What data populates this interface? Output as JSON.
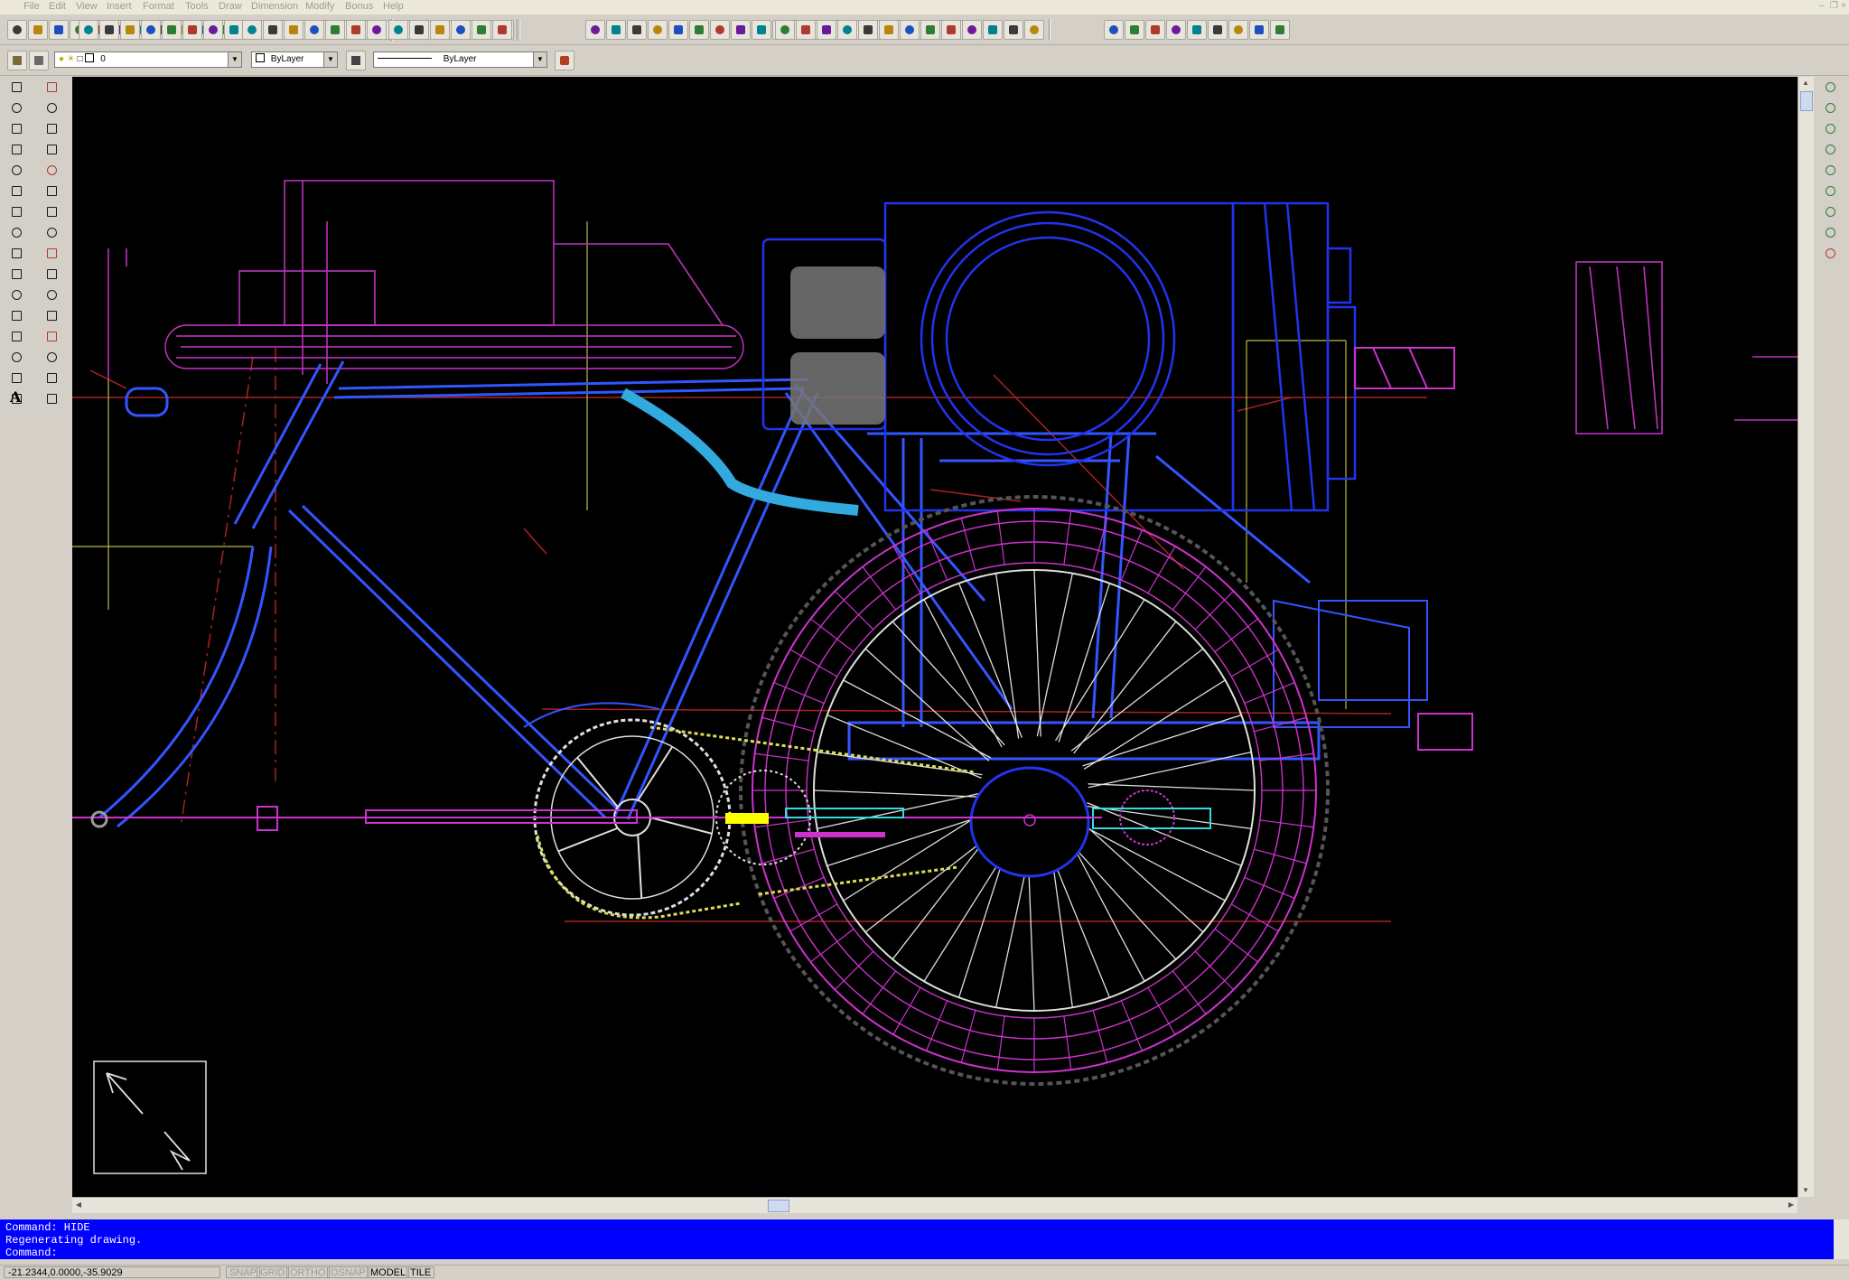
{
  "menu": {
    "items": [
      "File",
      "Edit",
      "View",
      "Insert",
      "Format",
      "Tools",
      "Draw",
      "Dimension",
      "Modify",
      "Bonus",
      "Help"
    ]
  },
  "properties": {
    "layer_name": "0",
    "color": "ByLayer",
    "linetype": "ByLayer"
  },
  "command_history": [
    "Command: HIDE",
    "Regenerating drawing."
  ],
  "command_prompt": "Command:",
  "status": {
    "coordinates": "-21.2344,0.0000,-35.9029",
    "toggles": [
      {
        "label": "SNAP",
        "on": false
      },
      {
        "label": "GRID",
        "on": false
      },
      {
        "label": "ORTHO",
        "on": false
      },
      {
        "label": "OSNAP",
        "on": false
      },
      {
        "label": "MODEL",
        "on": true
      },
      {
        "label": "TILE",
        "on": true
      }
    ]
  },
  "icons": {
    "ucs": "ucs-icon",
    "window_minimize": "minimize-icon",
    "window_restore": "restore-icon",
    "window_close": "close-icon"
  },
  "colors": {
    "canvas": "#000000",
    "command_bg": "#0000ff",
    "frame_blue": "#3355ff",
    "tire_magenta": "#cc33cc",
    "spoke_white": "#e0e0e0",
    "chain_yellow": "#dddd55",
    "hose_cyan": "#33aadd"
  }
}
